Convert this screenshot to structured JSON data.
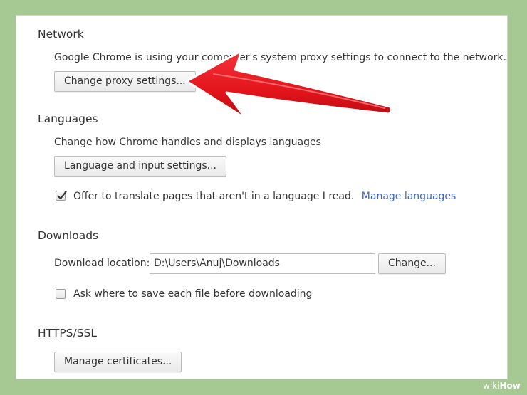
{
  "network": {
    "title": "Network",
    "description": "Google Chrome is using your computer's system proxy settings to connect to the network.",
    "proxy_button": "Change proxy settings..."
  },
  "languages": {
    "title": "Languages",
    "description": "Change how Chrome handles and displays languages",
    "input_button": "Language and input settings...",
    "translate_label": "Offer to translate pages that aren't in a language I read.",
    "translate_checked": true,
    "manage_link": "Manage languages"
  },
  "downloads": {
    "title": "Downloads",
    "location_label": "Download location:",
    "location_value": "D:\\Users\\Anuj\\Downloads",
    "change_button": "Change...",
    "ask_label": "Ask where to save each file before downloading",
    "ask_checked": false
  },
  "https": {
    "title": "HTTPS/SSL",
    "certificates_button": "Manage certificates..."
  },
  "watermark": {
    "wiki": "wiki",
    "how": "How"
  },
  "colors": {
    "background": "#a6c993",
    "link": "#3b64c5",
    "arrow": "#e3141b"
  }
}
